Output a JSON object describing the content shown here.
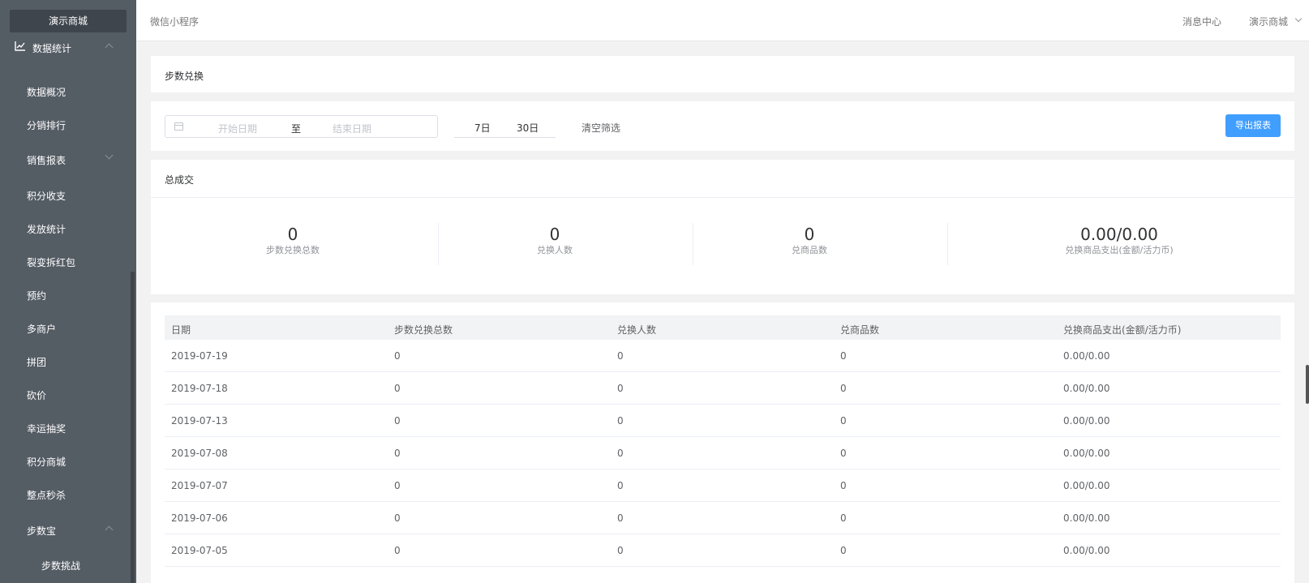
{
  "sidebar": {
    "brand": "演示商城",
    "section": "数据统计",
    "items": [
      "数据概况",
      "分销排行",
      "销售报表",
      "积分收支",
      "发放统计",
      "裂变拆红包",
      "预约",
      "多商户",
      "拼团",
      "砍价",
      "幸运抽奖",
      "积分商城",
      "整点秒杀",
      "步数宝"
    ],
    "sub_item": "步数挑战"
  },
  "header": {
    "breadcrumb": "微信小程序",
    "messages": "消息中心",
    "user": "演示商城"
  },
  "page": {
    "title": "步数兑换"
  },
  "filter": {
    "start_placeholder": "开始日期",
    "separator": "至",
    "end_placeholder": "结束日期",
    "quick_7": "7日",
    "quick_30": "30日",
    "clear": "清空筛选",
    "export": "导出报表"
  },
  "stats": {
    "title": "总成交",
    "items": [
      {
        "value": "0",
        "label": "步数兑换总数"
      },
      {
        "value": "0",
        "label": "兑换人数"
      },
      {
        "value": "0",
        "label": "兑商品数"
      },
      {
        "value": "0.00/0.00",
        "label": "兑换商品支出(金额/活力币)"
      }
    ]
  },
  "table": {
    "headers": [
      "日期",
      "步数兑换总数",
      "兑换人数",
      "兑商品数",
      "兑换商品支出(金额/活力币)"
    ],
    "rows": [
      [
        "2019-07-19",
        "0",
        "0",
        "0",
        "0.00/0.00"
      ],
      [
        "2019-07-18",
        "0",
        "0",
        "0",
        "0.00/0.00"
      ],
      [
        "2019-07-13",
        "0",
        "0",
        "0",
        "0.00/0.00"
      ],
      [
        "2019-07-08",
        "0",
        "0",
        "0",
        "0.00/0.00"
      ],
      [
        "2019-07-07",
        "0",
        "0",
        "0",
        "0.00/0.00"
      ],
      [
        "2019-07-06",
        "0",
        "0",
        "0",
        "0.00/0.00"
      ],
      [
        "2019-07-05",
        "0",
        "0",
        "0",
        "0.00/0.00"
      ]
    ]
  },
  "colors": {
    "sidebar_bg": "#545c64",
    "accent": "#409eff"
  }
}
